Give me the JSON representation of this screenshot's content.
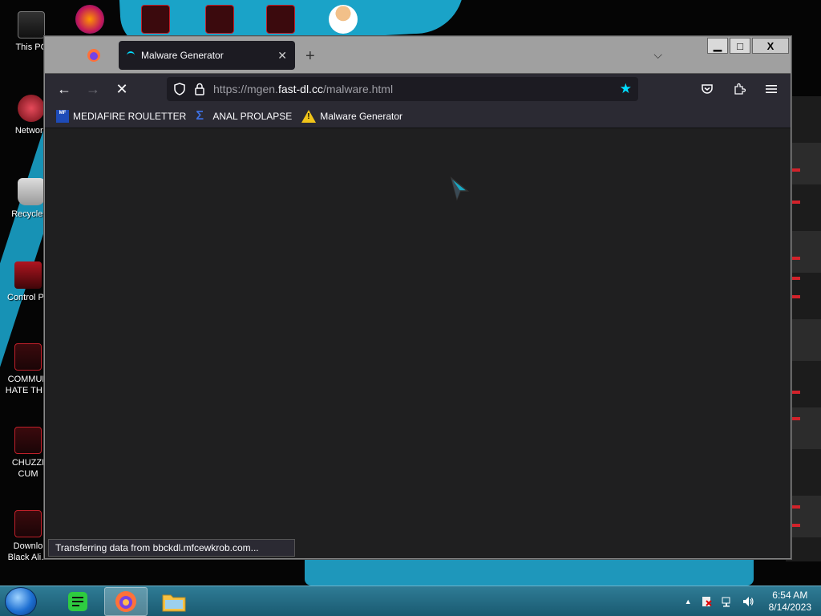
{
  "desktop": {
    "icons": [
      {
        "label": "This PC"
      },
      {
        "label": "Network"
      },
      {
        "label": "Recycle B"
      },
      {
        "label": "Control Pa"
      },
      {
        "label": "COMMUN HATE THIS"
      },
      {
        "label": "CHUZZI CUM"
      },
      {
        "label": "Downlo Black Ali..."
      }
    ]
  },
  "browser": {
    "tab": {
      "title": "Malware Generator",
      "close": "✕"
    },
    "new_tab": "+",
    "tab_list": "⌵",
    "window_controls": {
      "minimize": "▁",
      "maximize": "□",
      "close": "X"
    },
    "nav": {
      "back": "←",
      "forward": "→",
      "stop": "✕"
    },
    "url": {
      "prefix": "https://mgen.",
      "host": "fast-dl.cc",
      "path": "/malware.html"
    },
    "bookmarks": [
      {
        "label": "MEDIAFIRE ROULETTER",
        "icon_text": "MF"
      },
      {
        "label": "ANAL PROLAPSE",
        "icon_text": "Σ"
      },
      {
        "label": "Malware Generator",
        "icon_text": "!"
      }
    ],
    "status": "Transferring data from bbckdl.mfcewkrob.com..."
  },
  "taskbar": {
    "time": "6:54 AM",
    "date": "8/14/2023",
    "tray_arrow": "▲"
  },
  "colors": {
    "accent": "#00ddff",
    "taskbar": "#2f7c96",
    "page_bg": "#1f1f20"
  }
}
